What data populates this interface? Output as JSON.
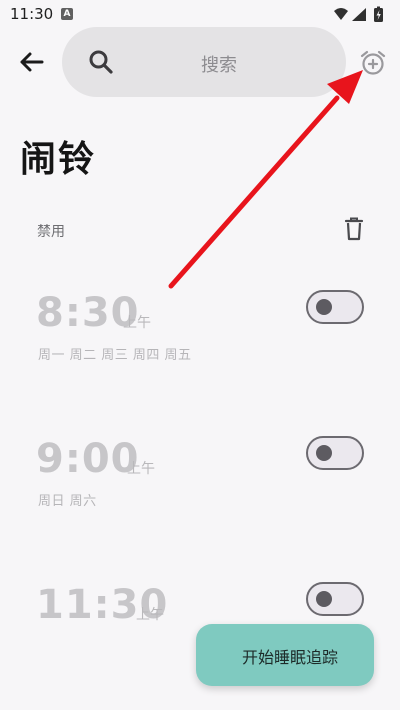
{
  "status_bar": {
    "time": "11:30",
    "notification_badge": "A",
    "icons": [
      "wifi-icon",
      "signal-icon",
      "battery-charging-icon"
    ]
  },
  "header": {
    "search_placeholder": "搜索",
    "back_icon": "arrow-left-icon",
    "add_alarm_icon": "alarm-add-icon"
  },
  "page_title": "闹铃",
  "section": {
    "label": "禁用",
    "delete_icon": "trash-icon"
  },
  "alarms": [
    {
      "time": "8:30",
      "ampm": "上午",
      "days": "周一 周二 周三 周四 周五",
      "enabled": false
    },
    {
      "time": "9:00",
      "ampm": "上午",
      "days": "周日 周六",
      "enabled": false
    },
    {
      "time": "11:30",
      "ampm": "上午",
      "days": "",
      "enabled": false
    }
  ],
  "fab": {
    "label": "开始睡眠追踪"
  },
  "colors": {
    "background": "#f7f6f8",
    "search_bg": "#e4e3e5",
    "fab_bg": "#7fcac0",
    "annotation_arrow": "#e8141c",
    "disabled_text": "#c7c6c9"
  }
}
